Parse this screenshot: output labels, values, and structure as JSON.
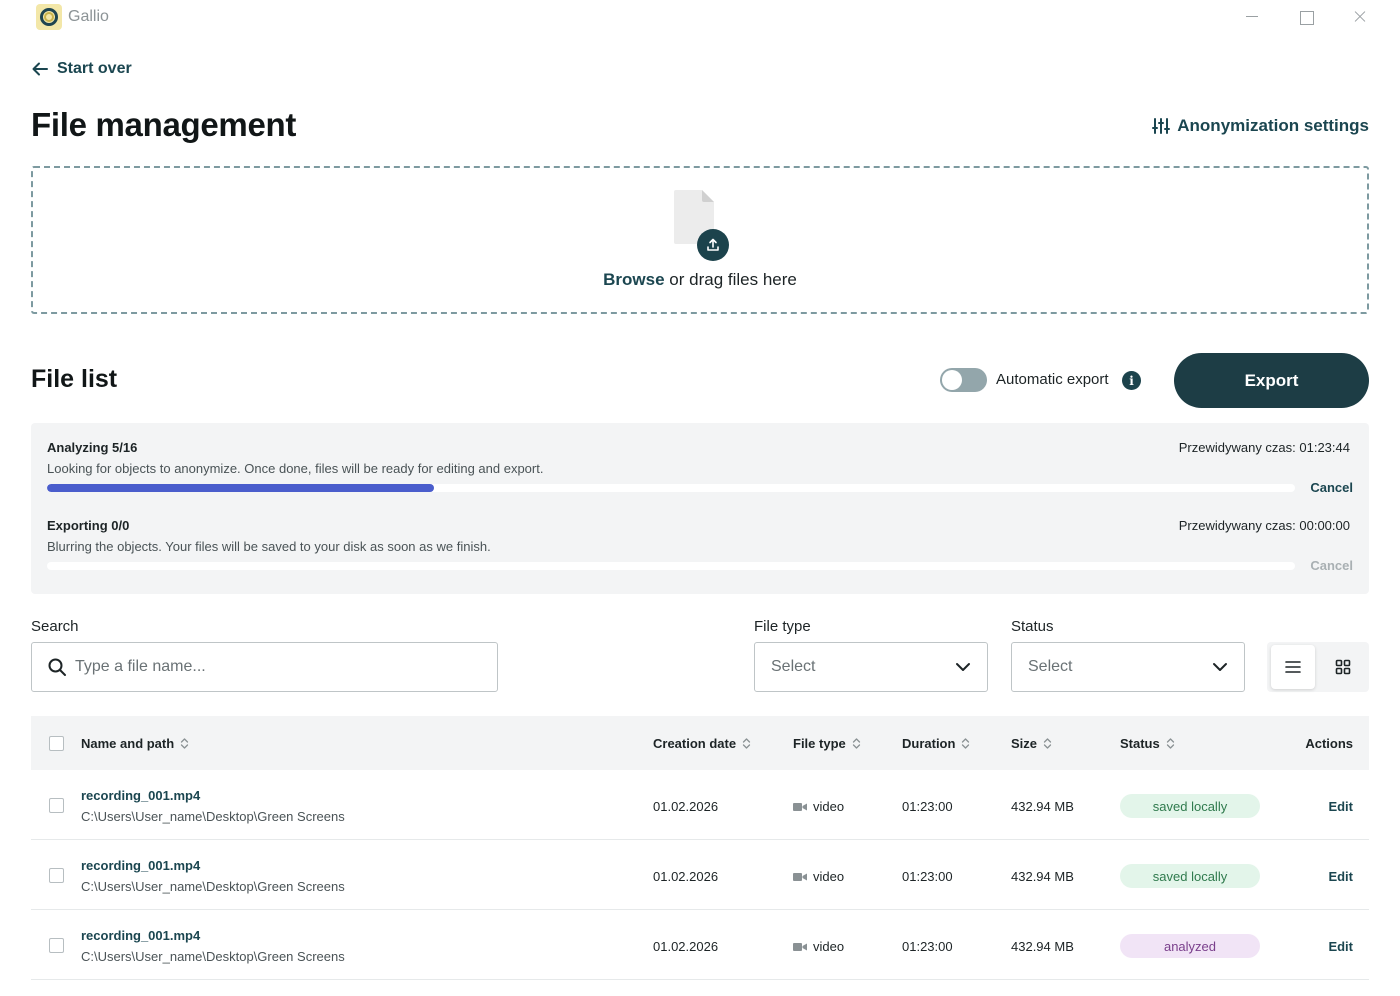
{
  "app": {
    "name": "Gallio"
  },
  "header": {
    "back_label": "Start over",
    "title": "File management",
    "settings_label": "Anonymization settings"
  },
  "dropzone": {
    "browse_label": "Browse",
    "rest_label": " or drag files here"
  },
  "file_list": {
    "title": "File list",
    "auto_export_label": "Automatic export",
    "auto_export_on": false,
    "info_glyph": "i",
    "export_label": "Export"
  },
  "progress": [
    {
      "title": "Analyzing 5/16",
      "eta": "Przewidywany czas: 01:23:44",
      "description": "Looking for objects to anonymize. Once done, files will be ready for editing and export.",
      "fraction": 0.31,
      "cancel_label": "Cancel",
      "cancel_enabled": true
    },
    {
      "title": "Exporting 0/0",
      "eta": "Przewidywany czas: 00:00:00",
      "description": "Blurring the objects. Your files will be saved to your disk as soon as we finish.",
      "fraction": 0,
      "cancel_label": "Cancel",
      "cancel_enabled": false
    }
  ],
  "filters": {
    "search_label": "Search",
    "search_placeholder": "Type a file name...",
    "filetype_label": "File type",
    "filetype_value": "Select",
    "status_label": "Status",
    "status_value": "Select",
    "view_active": "list"
  },
  "table": {
    "columns": {
      "name": "Name and path",
      "date": "Creation date",
      "type": "File type",
      "duration": "Duration",
      "size": "Size",
      "status": "Status",
      "actions": "Actions"
    },
    "rows": [
      {
        "name": "recording_001.mp4",
        "path": "C:\\Users\\User_name\\Desktop\\Green Screens",
        "date": "01.02.2026",
        "type": "video",
        "duration": "01:23:00",
        "size": "432.94 MB",
        "status": "saved locally",
        "action": "Edit"
      },
      {
        "name": "recording_001.mp4",
        "path": "C:\\Users\\User_name\\Desktop\\Green Screens",
        "date": "01.02.2026",
        "type": "video",
        "duration": "01:23:00",
        "size": "432.94 MB",
        "status": "saved locally",
        "action": "Edit"
      },
      {
        "name": "recording_001.mp4",
        "path": "C:\\Users\\User_name\\Desktop\\Green Screens",
        "date": "01.02.2026",
        "type": "video",
        "duration": "01:23:00",
        "size": "432.94 MB",
        "status": "analyzed",
        "action": "Edit"
      }
    ]
  },
  "colors": {
    "brand_dark": "#1d3d45",
    "accent_text": "#1b4650",
    "progress_fill": "#4a5dcc",
    "status_saved_bg": "#e3f5ea",
    "status_saved_fg": "#2f7a4d",
    "status_analyzed_bg": "#f1e4f6",
    "status_analyzed_fg": "#7a3f8c"
  },
  "icons": {
    "back": "arrow-left-icon",
    "settings": "sliders-icon",
    "file": "file-icon",
    "upload": "upload-icon",
    "search": "search-icon",
    "dropdown": "chevron-down-icon",
    "list_view": "list-view-icon",
    "grid_view": "grid-view-icon",
    "sort": "sort-icon",
    "video": "video-camera-icon"
  }
}
